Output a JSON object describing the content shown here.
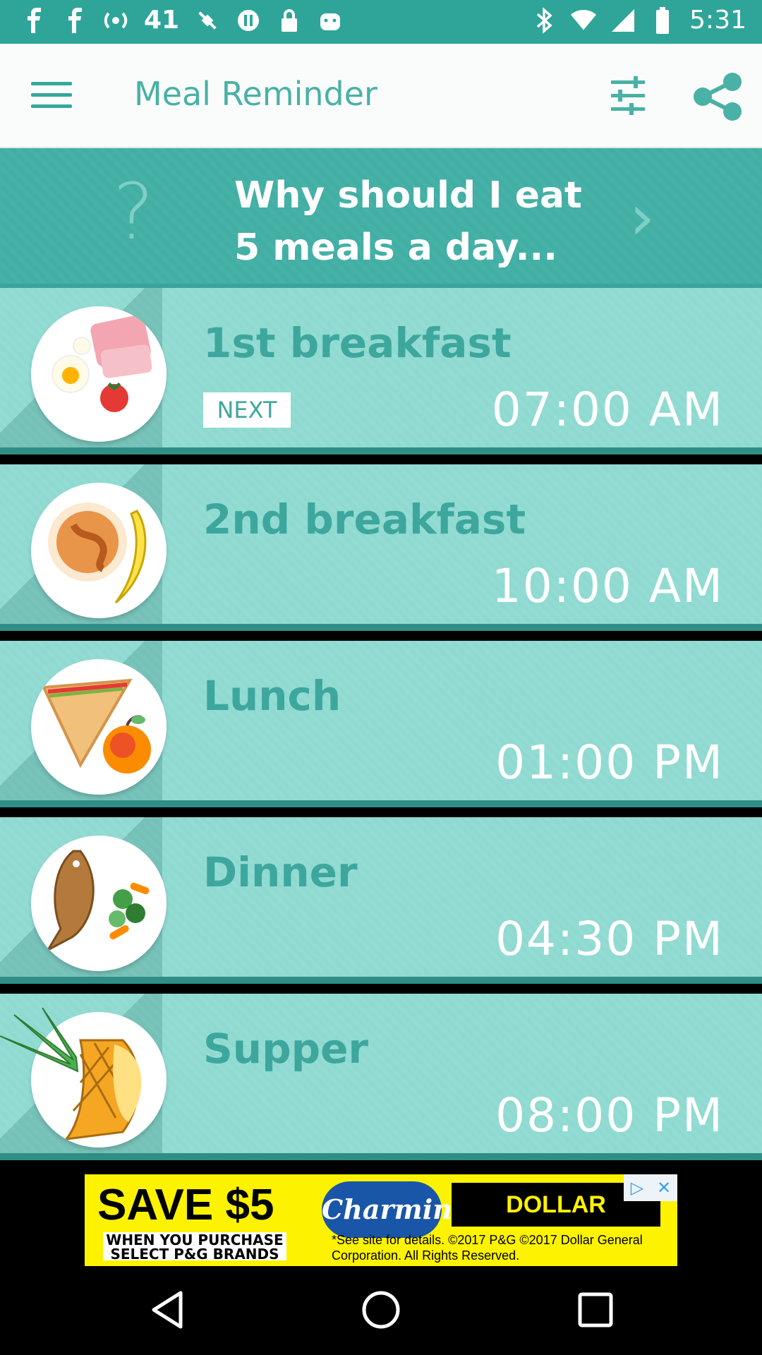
{
  "status_bar": {
    "time": "5:31",
    "notification": "41",
    "icons_left": [
      "facebook-icon",
      "facebook-icon",
      "radio-icon",
      "fake-gps-icon",
      "pause-icon",
      "lock-icon",
      "android-icon"
    ],
    "icons_right": [
      "bluetooth-icon",
      "wifi-icon",
      "signal-icon",
      "battery-icon"
    ]
  },
  "app_bar": {
    "title": "Meal Reminder"
  },
  "tip": {
    "question_icon": "?",
    "text": "Why should I eat 5 meals a day...",
    "arrow": "›"
  },
  "meals": [
    {
      "name": "1st breakfast",
      "time": "07:00 AM",
      "badge": "NEXT"
    },
    {
      "name": "2nd breakfast",
      "time": "10:00 AM"
    },
    {
      "name": "Lunch",
      "time": "01:00 PM"
    },
    {
      "name": "Dinner",
      "time": "04:30 PM"
    },
    {
      "name": "Supper",
      "time": "08:00 PM"
    }
  ],
  "ad": {
    "save": "SAVE $5",
    "save_sub": "WHEN YOU PURCHASE SELECT P&G BRANDS",
    "brand": "Charmin",
    "store": "DOLLAR GENERAL",
    "fine": "*See site for details. ©2017 P&G ©2017 Dollar General Corporation. All Rights Reserved."
  },
  "colors": {
    "teal": "#3ea79d",
    "tip_bg": "#42aea4",
    "row_bg": "#8fd9d0",
    "ad_bg": "#fdf200"
  }
}
